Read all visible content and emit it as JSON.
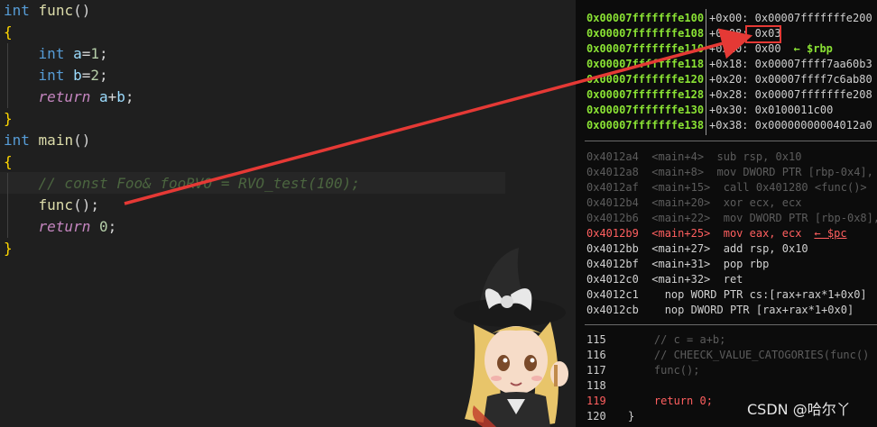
{
  "editor": {
    "lines": [
      {
        "kw": "int",
        "fn": "func",
        "rest": "()"
      },
      {
        "brace": "{"
      },
      {
        "kw": "int",
        "var": "a",
        "op": "=",
        "num": "1",
        "end": ";"
      },
      {
        "kw": "int",
        "var": "b",
        "op": "=",
        "num": "2",
        "end": ";"
      },
      {
        "ctl": "return",
        "expr_a": "a",
        "plus": "+",
        "expr_b": "b",
        "end": ";"
      },
      {
        "brace": "}"
      },
      {
        "kw": "int",
        "fn": "main",
        "rest": "()"
      },
      {
        "brace": "{"
      },
      {
        "comment": "// const Foo& fooRVO = RVO_test(100);"
      },
      {
        "fn": "func",
        "rest": "();"
      },
      {
        "ctl": "return",
        "num": "0",
        "end": ";"
      },
      {
        "brace": "}"
      }
    ]
  },
  "stack": [
    {
      "addr": "0x00007fffffffe100",
      "off": "+0x00:",
      "val": "0x00007fffffffe200",
      "note": ""
    },
    {
      "addr": "0x00007fffffffe108",
      "off": "+0x08:",
      "val": "0x03",
      "note": ""
    },
    {
      "addr": "0x00007fffffffe110",
      "off": "+0x10:",
      "val": "0x00",
      "note": "← $rbp"
    },
    {
      "addr": "0x00007fffffffe118",
      "off": "+0x18:",
      "val": "0x00007ffff7aa60b3",
      "note": ""
    },
    {
      "addr": "0x00007fffffffe120",
      "off": "+0x20:",
      "val": "0x00007ffff7c6ab80",
      "note": ""
    },
    {
      "addr": "0x00007fffffffe128",
      "off": "+0x28:",
      "val": "0x00007fffffffe208",
      "note": ""
    },
    {
      "addr": "0x00007fffffffe130",
      "off": "+0x30:",
      "val": "0x0100011c00",
      "note": ""
    },
    {
      "addr": "0x00007fffffffe138",
      "off": "+0x38:",
      "val": "0x00000000004012a0",
      "note": ""
    }
  ],
  "asm": [
    {
      "text": "0x4012a4  <main+4>  sub rsp, 0x10",
      "state": "dim",
      "note": ""
    },
    {
      "text": "0x4012a8  <main+8>  mov DWORD PTR [rbp-0x4], 0",
      "state": "dim",
      "note": ""
    },
    {
      "text": "0x4012af  <main+15>  call 0x401280 <func()>",
      "state": "dim",
      "note": ""
    },
    {
      "text": "0x4012b4  <main+20>  xor ecx, ecx",
      "state": "dim",
      "note": ""
    },
    {
      "text": "0x4012b6  <main+22>  mov DWORD PTR [rbp-0x8],",
      "state": "dim",
      "note": ""
    },
    {
      "text": "0x4012b9  <main+25>  mov eax, ecx",
      "state": "cur",
      "note": "← $pc"
    },
    {
      "text": "0x4012bb  <main+27>  add rsp, 0x10",
      "state": "norm",
      "note": ""
    },
    {
      "text": "0x4012bf  <main+31>  pop rbp",
      "state": "norm",
      "note": ""
    },
    {
      "text": "0x4012c0  <main+32>  ret",
      "state": "norm",
      "note": ""
    },
    {
      "text": "0x4012c1    nop WORD PTR cs:[rax+rax*1+0x0]",
      "state": "norm",
      "note": ""
    },
    {
      "text": "0x4012cb    nop DWORD PTR [rax+rax*1+0x0]",
      "state": "norm",
      "note": ""
    }
  ],
  "source": [
    {
      "num": "115",
      "code": "    // c = a+b;",
      "state": "dim"
    },
    {
      "num": "116",
      "code": "    // CHEECK_VALUE_CATOGORIES(func()",
      "state": "dim"
    },
    {
      "num": "117",
      "code": "    func();",
      "state": "dim"
    },
    {
      "num": "118",
      "code": "",
      "state": "dim"
    },
    {
      "num": "119",
      "code": "    return 0;",
      "state": "cur"
    },
    {
      "num": "120",
      "code": "}",
      "state": "norm"
    }
  ],
  "annotation": {
    "highlight_value": "0x03",
    "arrow_color": "#e53935"
  },
  "watermark": "CSDN @哈尔丫",
  "colors": {
    "keyword": "#569cd6",
    "function": "#dcdcaa",
    "number": "#b5cea8",
    "address": "#8ae234",
    "current": "#ff5f5f"
  }
}
